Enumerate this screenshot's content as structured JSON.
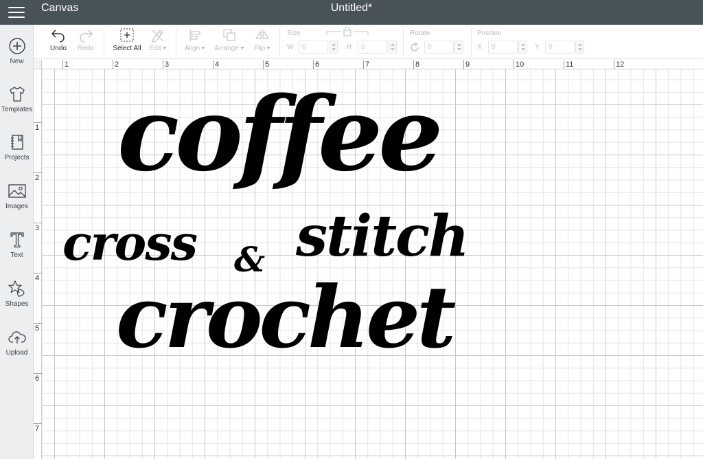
{
  "header": {
    "app_name": "Canvas",
    "doc_title": "Untitled*"
  },
  "sidebar": {
    "items": [
      {
        "label": "New",
        "icon": "plus-circle-icon"
      },
      {
        "label": "Templates",
        "icon": "tshirt-icon"
      },
      {
        "label": "Projects",
        "icon": "projects-icon"
      },
      {
        "label": "Images",
        "icon": "image-icon"
      },
      {
        "label": "Text",
        "icon": "text-icon"
      },
      {
        "label": "Shapes",
        "icon": "shapes-icon"
      },
      {
        "label": "Upload",
        "icon": "cloud-upload-icon"
      }
    ]
  },
  "toolbar": {
    "undo": "Undo",
    "redo": "Redo",
    "select_all": "Select All",
    "edit": "Edit",
    "align": "Align",
    "arrange": "Arrange",
    "flip": "Flip",
    "size_label": "Size",
    "w_label": "W",
    "w_value": "0",
    "h_label": "H",
    "h_value": "0",
    "rotate_label": "Rotate",
    "rotate_value": "0",
    "position_label": "Position",
    "x_label": "X",
    "x_value": "0",
    "y_label": "Y",
    "y_value": "0"
  },
  "rulers": {
    "horizontal": [
      "1",
      "2",
      "3",
      "4",
      "5",
      "6",
      "7",
      "8",
      "9",
      "10",
      "11",
      "12"
    ],
    "vertical": [
      "1",
      "2",
      "3",
      "4",
      "5",
      "6",
      "7"
    ]
  },
  "canvas_text": {
    "line1": "coffee",
    "line2a": "cross",
    "line2b": "stitch",
    "amp": "&",
    "line3": "crochet"
  },
  "colors": {
    "topbar": "#475259",
    "sidebar": "#eceef0",
    "artwork": "#000000"
  }
}
